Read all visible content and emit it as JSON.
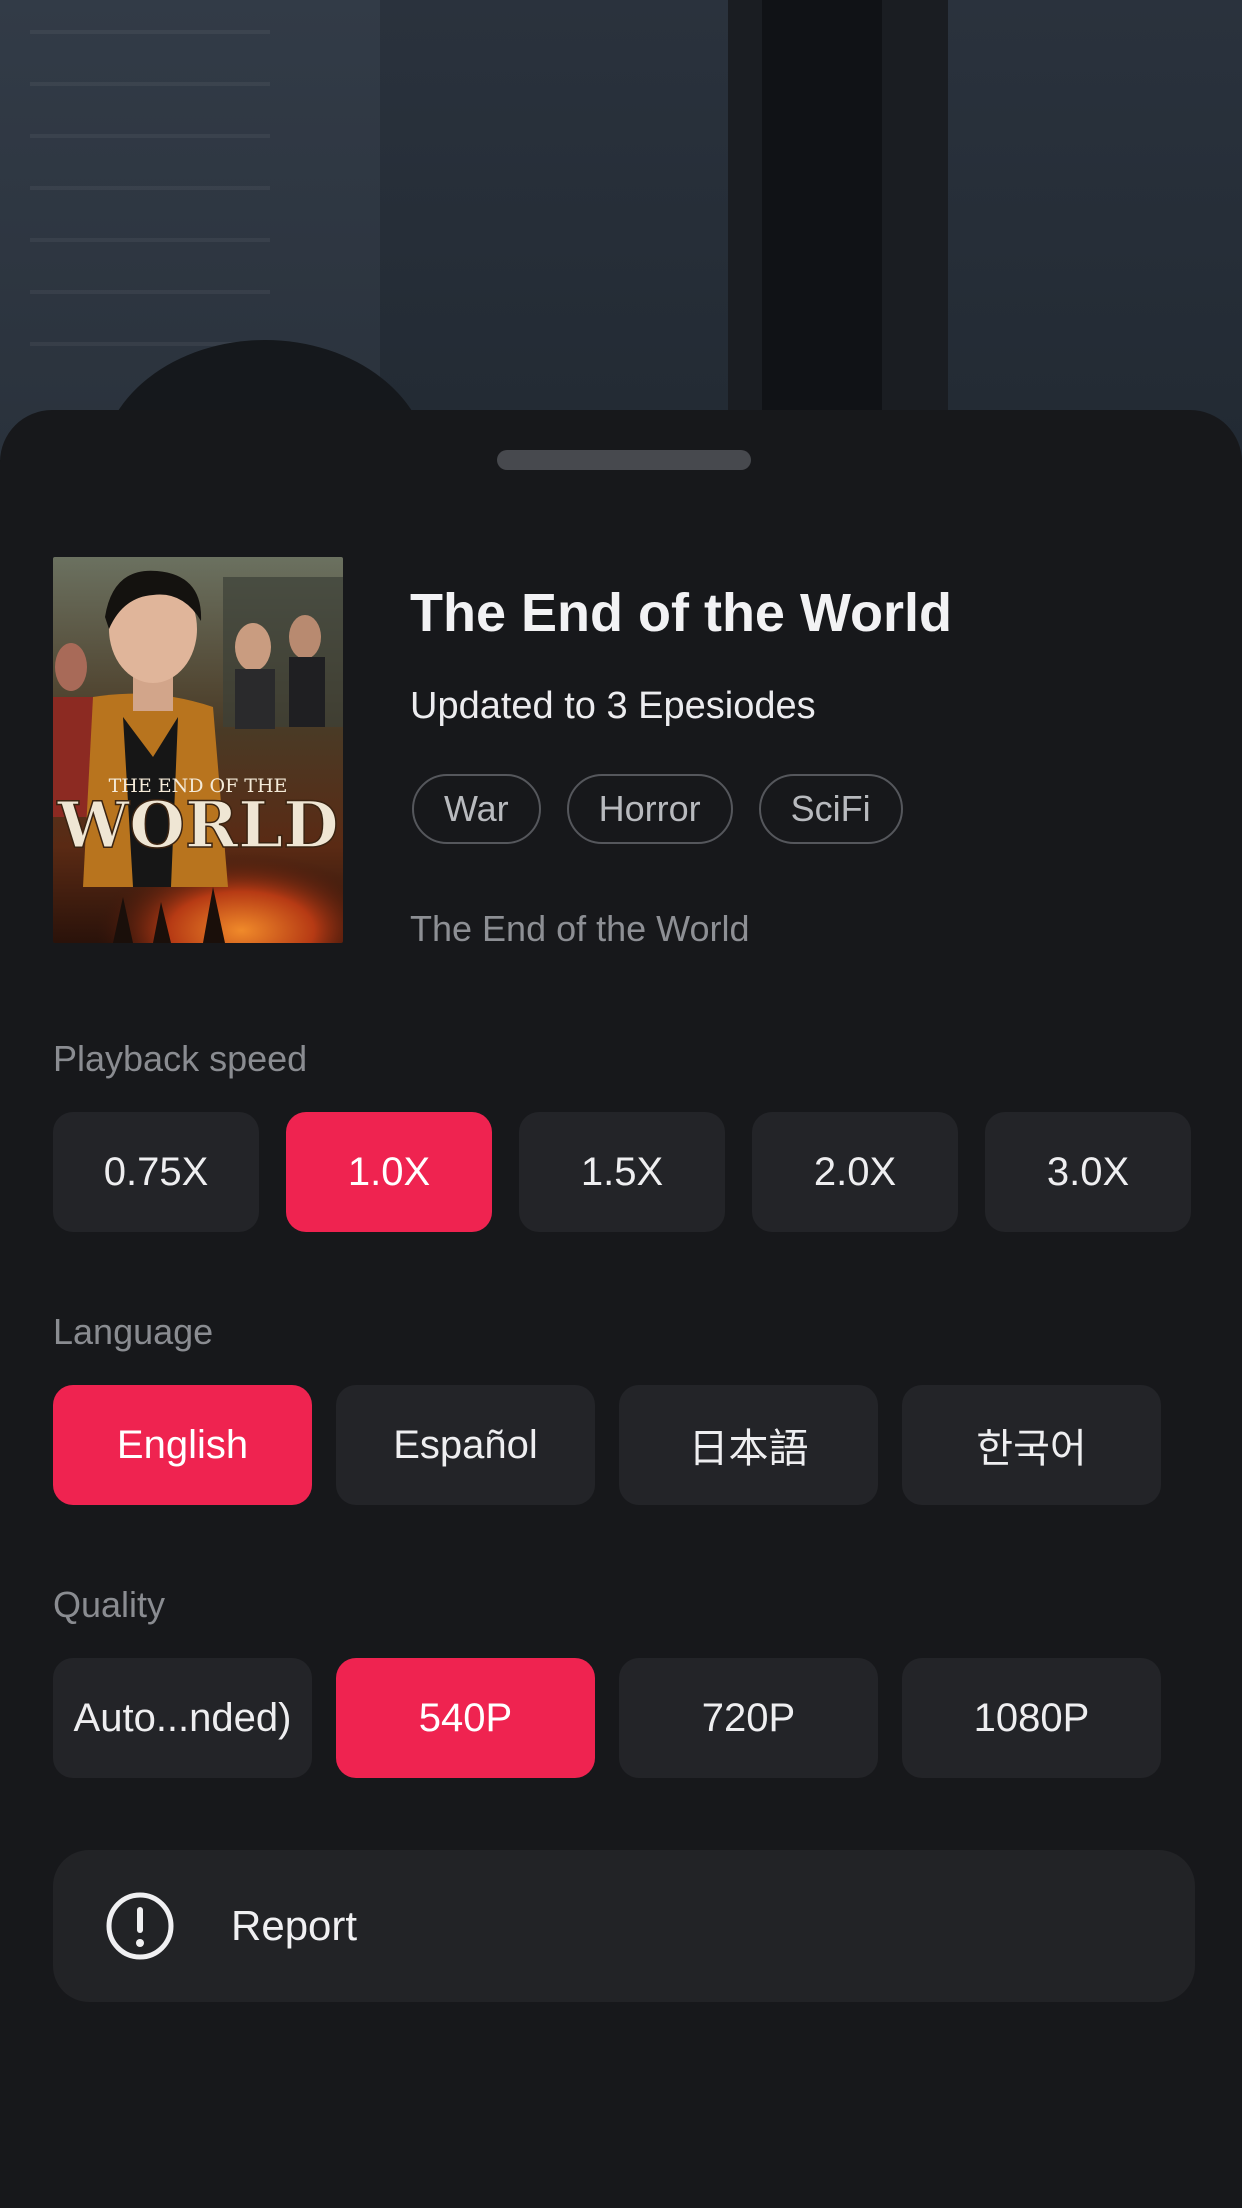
{
  "show": {
    "title": "The End of the World",
    "updated": "Updated to 3 Epesiodes",
    "tags": [
      "War",
      "Horror",
      "SciFi"
    ],
    "description": "The End of the World",
    "poster": {
      "line1": "THE END OF THE",
      "line2": "WORLD"
    }
  },
  "playback_speed": {
    "label": "Playback speed",
    "options": [
      "0.75X",
      "1.0X",
      "1.5X",
      "2.0X",
      "3.0X"
    ],
    "selected": "1.0X"
  },
  "language": {
    "label": "Language",
    "options": [
      "English",
      "Español",
      "日本語",
      "한국어"
    ],
    "selected": "English"
  },
  "quality": {
    "label": "Quality",
    "options": [
      "Auto...nded)",
      "540P",
      "720P",
      "1080P"
    ],
    "selected": "540P"
  },
  "report": {
    "label": "Report",
    "icon": "alert-circle-icon"
  },
  "colors": {
    "accent": "#ef2350",
    "sheet": "#17181b",
    "option": "#232428"
  }
}
